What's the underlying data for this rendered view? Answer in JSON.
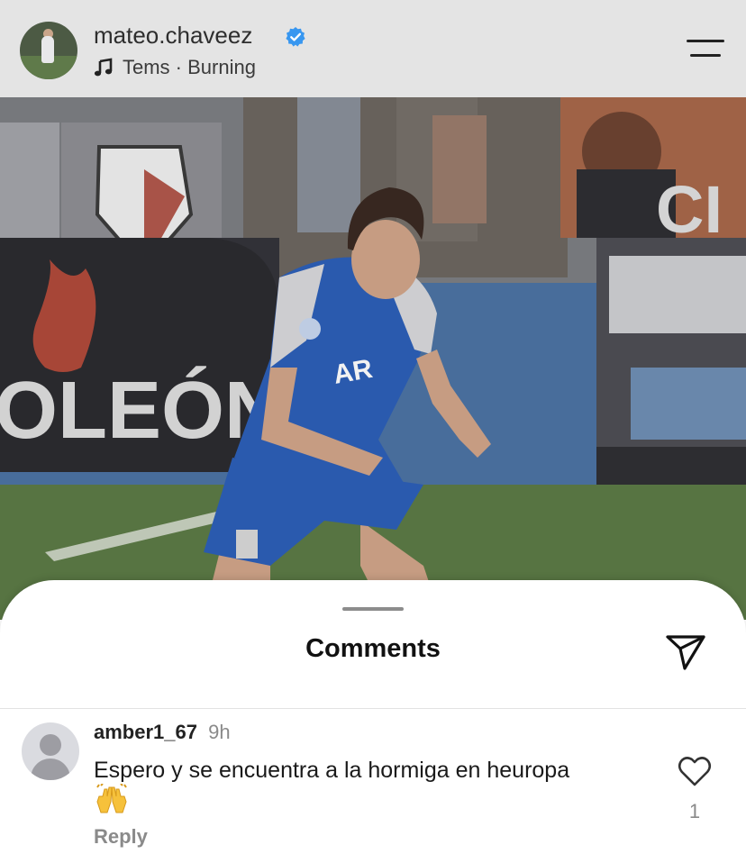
{
  "header": {
    "username": "mateo.chaveez",
    "music": "Tems · Burning",
    "verified_color": "#3897f0"
  },
  "photo": {
    "ad_text": "OLEÓN",
    "banner_text": "CI",
    "jersey_text": "AR",
    "jersey_color": "#2d5fb8"
  },
  "comments_sheet": {
    "title": "Comments",
    "comment": {
      "username": "amber1_67",
      "time": "9h",
      "text": "Espero y se encuentra a la hormiga en heuropa",
      "emoji": "raising-hands",
      "reply_label": "Reply",
      "like_count": "1"
    }
  }
}
